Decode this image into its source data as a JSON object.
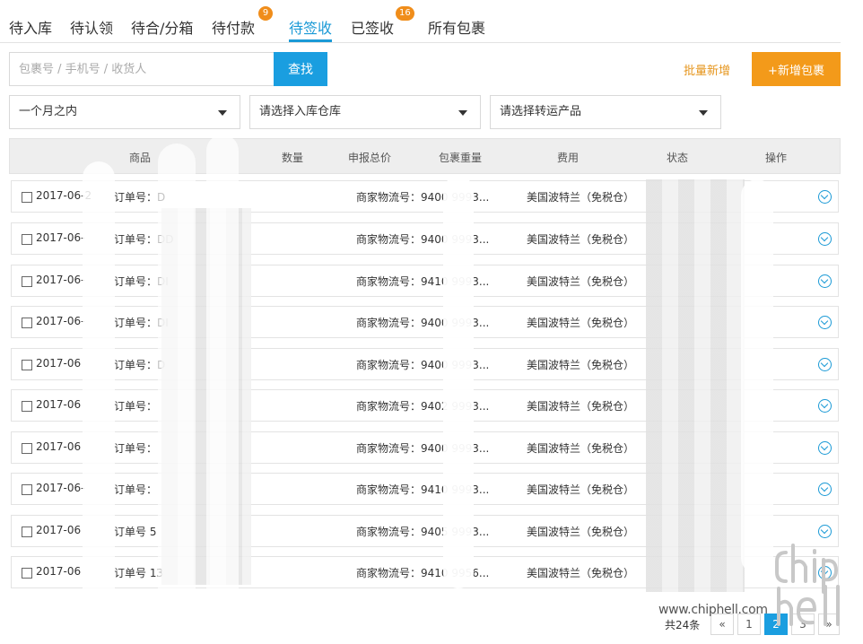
{
  "tabs": [
    {
      "label": "待入库"
    },
    {
      "label": "待认领"
    },
    {
      "label": "待合/分箱"
    },
    {
      "label": "待付款",
      "badge": "9"
    },
    {
      "label": "待签收",
      "active": true
    },
    {
      "label": "已签收",
      "badge": "16"
    },
    {
      "label": "所有包裹"
    }
  ],
  "search": {
    "placeholder": "包裹号 / 手机号 / 收货人",
    "button": "查找"
  },
  "actions": {
    "batch_add": "批量新增",
    "add_package": "+新增包裹"
  },
  "filters": {
    "time": "一个月之内",
    "warehouse": "请选择入库仓库",
    "product": "请选择转运产品"
  },
  "table": {
    "headers": [
      "商品",
      "数量",
      "申报总价",
      "包裹重量",
      "费用",
      "状态",
      "操作"
    ],
    "rows": [
      {
        "date": "2017-06-2",
        "order": "订单号：D",
        "track": "商家物流号：9400       9993...",
        "product": "美国波特兰（免税仓）"
      },
      {
        "date": "2017-06-",
        "order": "订单号：DD",
        "track": "商家物流号：9400       9993...",
        "product": "美国波特兰（免税仓）"
      },
      {
        "date": "2017-06-",
        "order": "订单号：DI",
        "track": "商家物流号：9410       9993...",
        "product": "美国波特兰（免税仓）"
      },
      {
        "date": "2017-06-",
        "order": "订单号：DI",
        "track": "商家物流号：9400       9993...",
        "product": "美国波特兰（免税仓）"
      },
      {
        "date": "2017-06",
        "order": "订单号：D",
        "track": "商家物流号：9400       9993...",
        "product": "美国波特兰（免税仓）"
      },
      {
        "date": "2017-06",
        "order": "订单号：",
        "track": "商家物流号：9402       9993...",
        "product": "美国波特兰（免税仓）"
      },
      {
        "date": "2017-06",
        "order": "订单号：",
        "track": "商家物流号：9400       9993...",
        "product": "美国波特兰（免税仓）"
      },
      {
        "date": "2017-06-",
        "order": "订单号：",
        "track": "商家物流号：9410       9993...",
        "product": "美国波特兰（免税仓）"
      },
      {
        "date": "2017-06",
        "order": "订单号            5",
        "track": "商家物流号：9405       9993...",
        "product": "美国波特兰（免税仓）"
      },
      {
        "date": "2017-06",
        "order": "订单号            13",
        "track": "商家物流号：9410       9956...",
        "product": "美国波特兰（免税仓）"
      }
    ]
  },
  "pagination": {
    "total": "共24条",
    "prev": "«",
    "pages": [
      "1",
      "2",
      "3"
    ],
    "current": "2",
    "next": "»"
  },
  "watermark": {
    "site": "www.chiphell.com"
  },
  "colors": {
    "accent_blue": "#1a9ee0",
    "accent_orange": "#f39a1a",
    "badge_orange": "#f08d1a"
  }
}
